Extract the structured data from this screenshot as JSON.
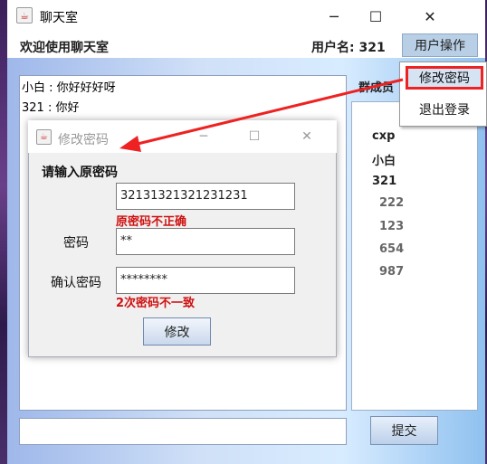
{
  "window": {
    "title": "聊天室",
    "minimize_icon": "─",
    "maximize_icon": "☐",
    "close_icon": "✕"
  },
  "menubar": {
    "welcome": "欢迎使用聊天室",
    "username": "用户名: 321",
    "user_menu": "用户操作"
  },
  "dropdown": {
    "items": [
      "修改密码",
      "退出登录"
    ]
  },
  "chat": {
    "messages": [
      "小白 : 你好好好呀",
      "321 : 你好"
    ]
  },
  "members": {
    "title": "群成员",
    "list": [
      "cxp",
      "小白",
      "321",
      "222",
      "123",
      "654",
      "987"
    ]
  },
  "submit_label": "提交",
  "dialog": {
    "title": "修改密码",
    "prompt": "请输入原密码",
    "old_password_value": "32131321321231231",
    "old_password_error": "原密码不正确",
    "password_label": "密码",
    "password_value": "**",
    "confirm_label": "确认密码",
    "confirm_value": "********",
    "confirm_error": "2次密码不一致",
    "submit_label": "修改"
  },
  "colors": {
    "error": "#d01010",
    "highlight": "#e22222"
  }
}
